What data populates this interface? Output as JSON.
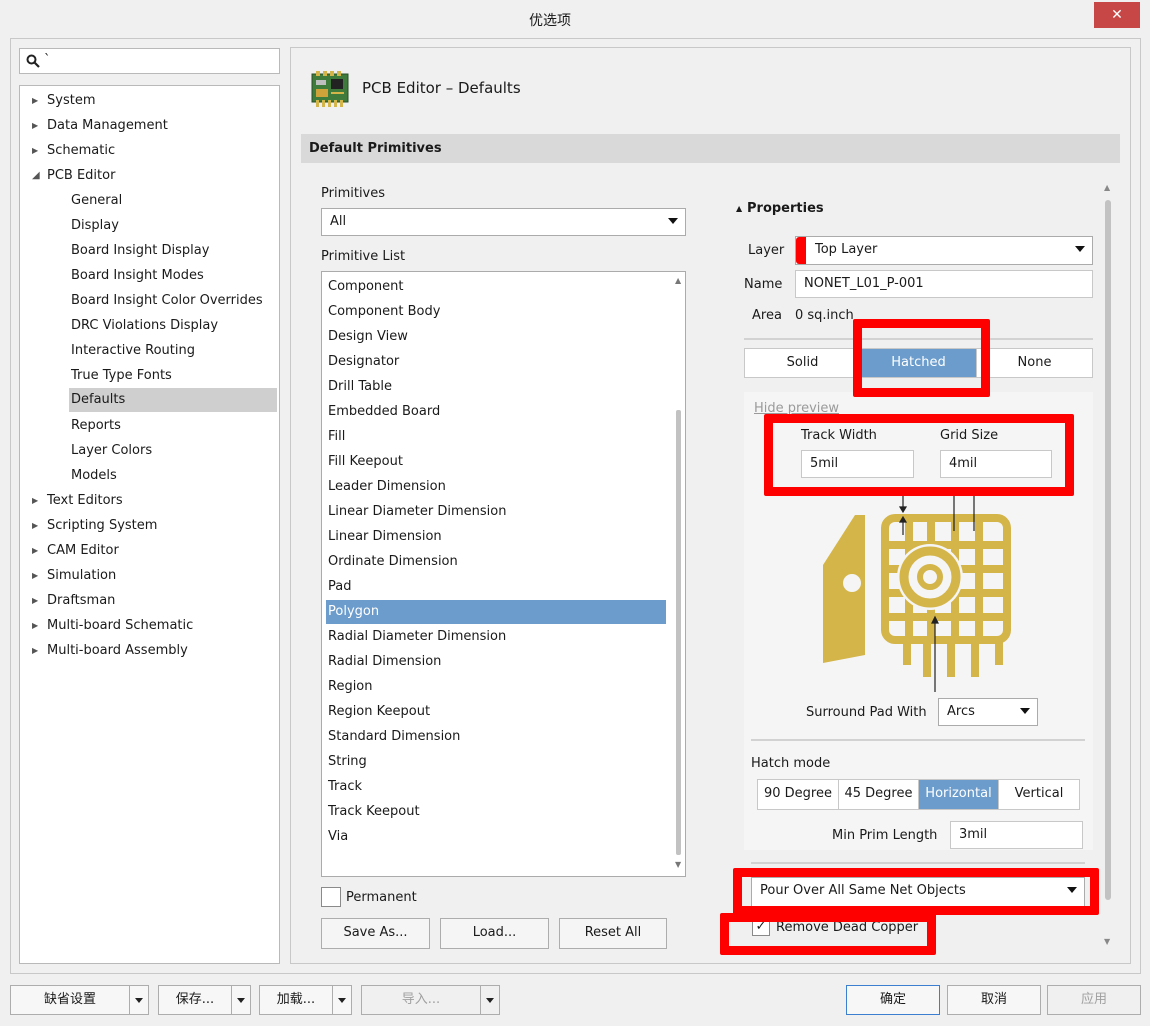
{
  "window": {
    "title": "优选项",
    "close_glyph": "✕"
  },
  "search": {
    "value": "`",
    "icon": "search-icon"
  },
  "tree": {
    "top": [
      {
        "label": "System"
      },
      {
        "label": "Data Management"
      },
      {
        "label": "Schematic"
      },
      {
        "label": "PCB Editor"
      }
    ],
    "pcb_children": [
      "General",
      "Display",
      "Board Insight Display",
      "Board Insight Modes",
      "Board Insight Color Overrides",
      "DRC Violations Display",
      "Interactive Routing",
      "True Type Fonts",
      "Defaults",
      "Reports",
      "Layer Colors",
      "Models"
    ],
    "bottom": [
      "Text Editors",
      "Scripting System",
      "CAM Editor",
      "Simulation",
      "Draftsman",
      "Multi-board Schematic",
      "Multi-board Assembly"
    ],
    "selected": "Defaults"
  },
  "page": {
    "heading": "PCB Editor – Defaults",
    "section": "Default Primitives"
  },
  "primitives": {
    "label": "Primitives",
    "filter_value": "All",
    "list_label": "Primitive List",
    "items": [
      "Component",
      "Component Body",
      "Design View",
      "Designator",
      "Drill Table",
      "Embedded Board",
      "Fill",
      "Fill Keepout",
      "Leader Dimension",
      "Linear Diameter Dimension",
      "Linear Dimension",
      "Ordinate Dimension",
      "Pad",
      "Polygon",
      "Radial Diameter Dimension",
      "Radial Dimension",
      "Region",
      "Region Keepout",
      "Standard Dimension",
      "String",
      "Track",
      "Track Keepout",
      "Via"
    ],
    "selected": "Polygon",
    "permanent_label": "Permanent",
    "permanent_checked": false,
    "save_as": "Save As...",
    "load": "Load...",
    "reset_all": "Reset All"
  },
  "properties": {
    "title": "Properties",
    "layer_label": "Layer",
    "layer_value": "Top Layer",
    "layer_color": "#ff0000",
    "name_label": "Name",
    "name_value": "NONET_L01_P-001",
    "area_label": "Area",
    "area_value": "0 sq.inch",
    "fill_modes": [
      "Solid",
      "Hatched",
      "None"
    ],
    "fill_selected": "Hatched",
    "hide_preview": "Hide preview",
    "track_width_label": "Track Width",
    "track_width_value": "5mil",
    "grid_size_label": "Grid Size",
    "grid_size_value": "4mil",
    "surround_label": "Surround Pad With",
    "surround_value": "Arcs",
    "hatch_mode_label": "Hatch mode",
    "hatch_modes": [
      "90 Degree",
      "45 Degree",
      "Horizontal",
      "Vertical"
    ],
    "hatch_selected": "Horizontal",
    "min_prim_label": "Min Prim Length",
    "min_prim_value": "3mil",
    "pour_value": "Pour Over All Same Net Objects",
    "remove_dead_label": "Remove Dead Copper",
    "remove_dead_checked": true,
    "copper_color": "#d4b54a",
    "highlight_color": "#ff0000"
  },
  "footer": {
    "defaults": "缺省设置",
    "save": "保存...",
    "load": "加载...",
    "import": "导入...",
    "ok": "确定",
    "cancel": "取消",
    "apply": "应用"
  }
}
